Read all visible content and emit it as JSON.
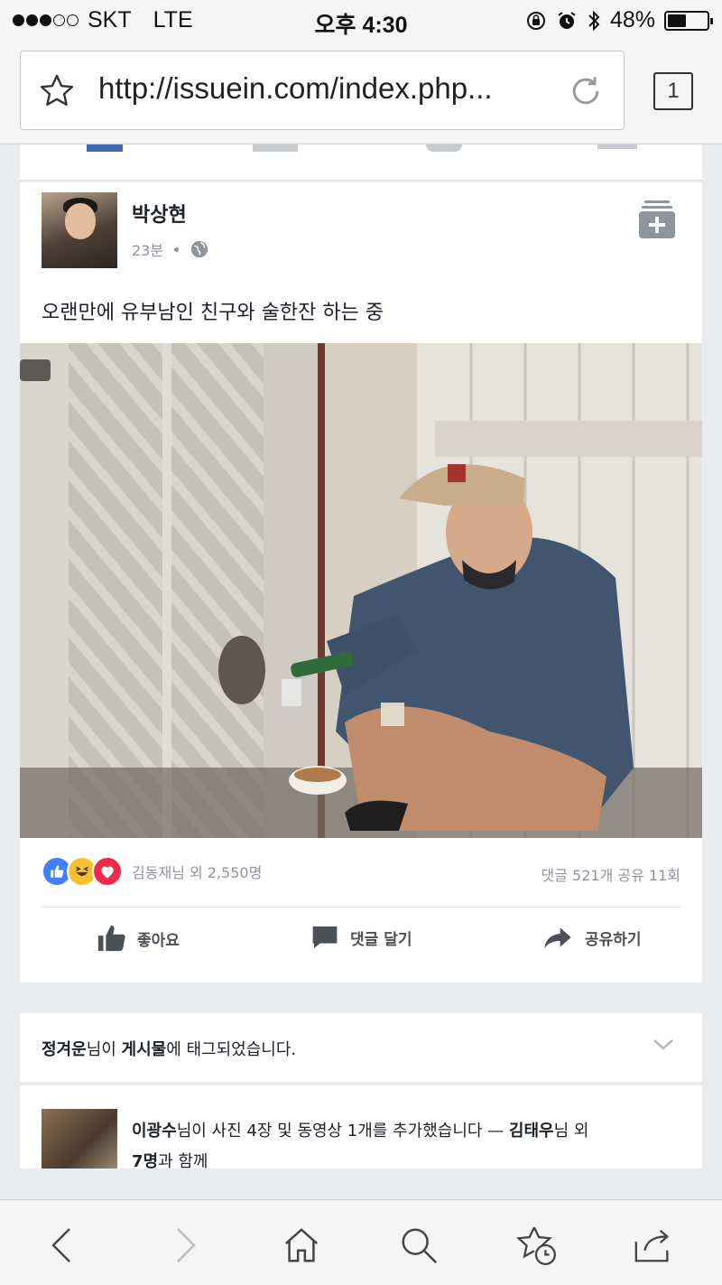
{
  "status_bar": {
    "carrier": "SKT",
    "network": "LTE",
    "time": "오후 4:30",
    "battery_percent": "48%",
    "battery_level": 0.48,
    "signal_bars_filled": 3,
    "signal_bars_total": 5
  },
  "browser": {
    "url": "http://issuein.com/index.php...",
    "tab_count": "1"
  },
  "post": {
    "author": "박상현",
    "time_ago": "23분",
    "privacy_icon": "globe-icon",
    "text": "오랜만에 유부남인 친구와 술한잔 하는 중",
    "reactions_text": "김동재님 외 2,550명",
    "counts_text": "댓글 521개 공유 11회",
    "actions": {
      "like": "좋아요",
      "comment": "댓글 달기",
      "share": "공유하기"
    }
  },
  "notice": {
    "name": "정겨운",
    "middle": "님이 ",
    "target": "게시물",
    "tail": "에 태그되었습니다."
  },
  "activity": {
    "name": "이광수",
    "text1": "님이 사진 4장 및 동영상 1개를 추가했습니다 — ",
    "name2": "김태우",
    "text2": "님 외",
    "line2_bold": "7명",
    "line2": "과 함께"
  },
  "colors": {
    "like_blue": "#4080ff",
    "haha_yellow": "#f7c12e",
    "love_red": "#f0284a"
  }
}
